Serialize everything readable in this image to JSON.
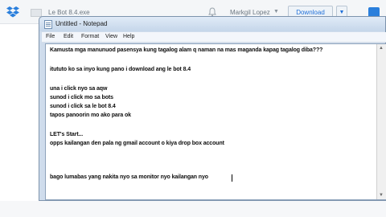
{
  "dropbox": {
    "file_name": "Le Bot 8.4.exe",
    "user_name": "Markgil Lopez",
    "user_chevron": "▼",
    "download_label": "Download",
    "more_label": "▼"
  },
  "notepad": {
    "title": "Untitled - Notepad",
    "menu": [
      "File",
      "Edit",
      "Format",
      "View",
      "Help"
    ],
    "lines": [
      "Kamusta mga manunuod pasensya kung tagalog alam q naman na mas maganda kapag tagalog diba???",
      "",
      "itututo ko sa inyo kung pano i download ang le bot 8.4",
      "",
      "una i click nyo sa aqw",
      "sunod i click mo sa bots",
      "sunod i click sa le bot 8.4",
      "tapos panoorin mo ako para ok",
      "",
      "LET's Start...",
      "opps kailangan den pala ng gmail account o kiya drop box account",
      "",
      "",
      "bago lumabas yang nakita nyo sa monitor nyo kailangan nyo"
    ],
    "scroll_up": "▲",
    "scroll_down": "▼"
  },
  "colors": {
    "dropbox_blue": "#2a7fdc",
    "window_frame": "#cfdcec"
  }
}
